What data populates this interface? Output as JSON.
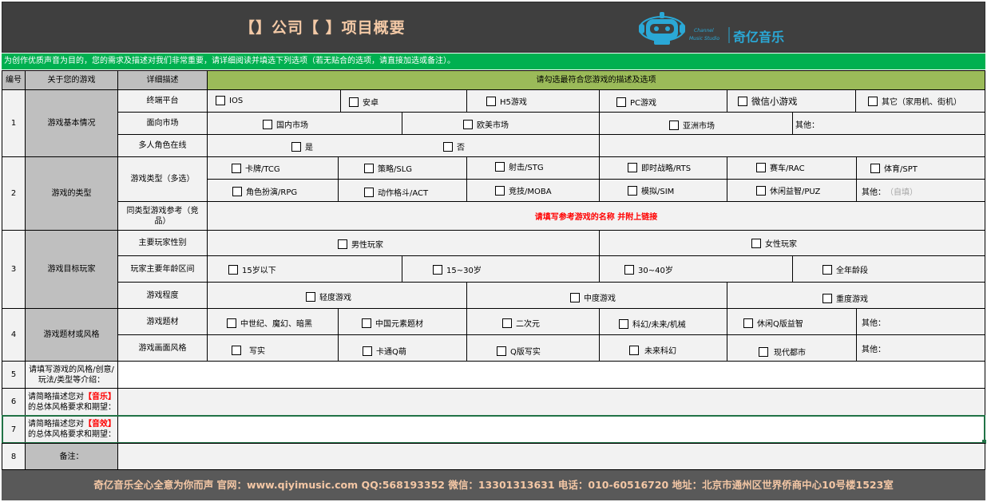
{
  "header": {
    "title": "【】公司【 】项目概要",
    "logo": {
      "brand": "奇亿音乐",
      "sub1": "Channel",
      "sub2": "Music Studio"
    }
  },
  "notice": "为创作优质声音为目的，您的需求及描述对我们非常重要，请详细阅读并填选下列选项（若无贴合的选项，请直接加选或备注）。",
  "columns": {
    "no": "编号",
    "about": "关于您的游戏",
    "detail": "详细描述",
    "options": "请勾选最符合您游戏的描述及选项"
  },
  "sections": {
    "s1": {
      "no": "1",
      "label": "游戏基本情况"
    },
    "s2": {
      "no": "2",
      "label": "游戏的类型"
    },
    "s3": {
      "no": "3",
      "label": "游戏目标玩家"
    },
    "s4": {
      "no": "4",
      "label": "游戏题材或风格"
    },
    "s5": {
      "no": "5",
      "label": "请填写游戏的风格/创意/玩法/类型等介绍："
    },
    "s6": {
      "no": "6",
      "label_a": "请简略描述您对",
      "label_hl": "【音乐】",
      "label_b": "的总体风格要求和期望："
    },
    "s7": {
      "no": "7",
      "label_a": "请简略描述您对",
      "label_hl": "【音效】",
      "label_b": "的总体风格要求和期望："
    },
    "s8": {
      "no": "8",
      "label": "备注："
    }
  },
  "rows": {
    "platform": {
      "label": "终端平台",
      "options": [
        "IOS",
        "安卓",
        "H5游戏",
        "PC游戏",
        "微信小游戏",
        "其它（家用机、街机）"
      ]
    },
    "market": {
      "label": "面向市场",
      "options": [
        "国内市场",
        "欧美市场",
        "亚洲市场"
      ],
      "other": "其他："
    },
    "multiplayer": {
      "label": "多人角色在线",
      "options": [
        "是",
        "否"
      ]
    },
    "genre": {
      "label": "游戏类型（多选）",
      "options1": [
        "卡牌/TCG",
        "策略/SLG",
        "射击/STG",
        "即时战略/RTS",
        "赛车/RAC",
        "体育/SPT"
      ],
      "options2": [
        "角色扮演/RPG",
        "动作格斗/ACT",
        "竞技/MOBA",
        "模拟/SIM",
        "休闲益智/PUZ"
      ],
      "other": "其他：",
      "other_hint": "（自填）"
    },
    "reference": {
      "label": "同类型游戏参考（竞品）",
      "hint": "请填写参考游戏的名称 并附上链接"
    },
    "gender": {
      "label": "主要玩家性别",
      "options": [
        "男性玩家",
        "女性玩家"
      ]
    },
    "age": {
      "label": "玩家主要年龄区间",
      "options": [
        "15岁以下",
        "15~30岁",
        "30~40岁",
        "全年龄段"
      ]
    },
    "degree": {
      "label": "游戏程度",
      "options": [
        "轻度游戏",
        "中度游戏",
        "重度游戏"
      ]
    },
    "theme": {
      "label": "游戏题材",
      "options": [
        "中世纪、魔幻、暗黑",
        "中国元素题材",
        "二次元",
        "科幻/未来/机械",
        "休闲Q版益智"
      ],
      "other": "其他："
    },
    "art": {
      "label": "游戏画面风格",
      "options": [
        "写实",
        "卡通Q萌",
        "Q版写实",
        "未来科幻",
        "现代都市"
      ],
      "other": "其他："
    }
  },
  "footer": "奇亿音乐全心全意为你而声   官网：www.qiyimusic.com  QQ:568193352   微信：13301313631   电话：010-60516720     地址：北京市通州区世界侨商中心10号楼1523室",
  "colors": {
    "header_bg": "#3f3f3f",
    "notice_bg": "#00b050",
    "options_header_bg": "#9bbb59",
    "label_bg": "#bfbfbf",
    "footer_bg": "#595959",
    "title_color": "#f3c9a6",
    "highlight": "#ff0000"
  }
}
